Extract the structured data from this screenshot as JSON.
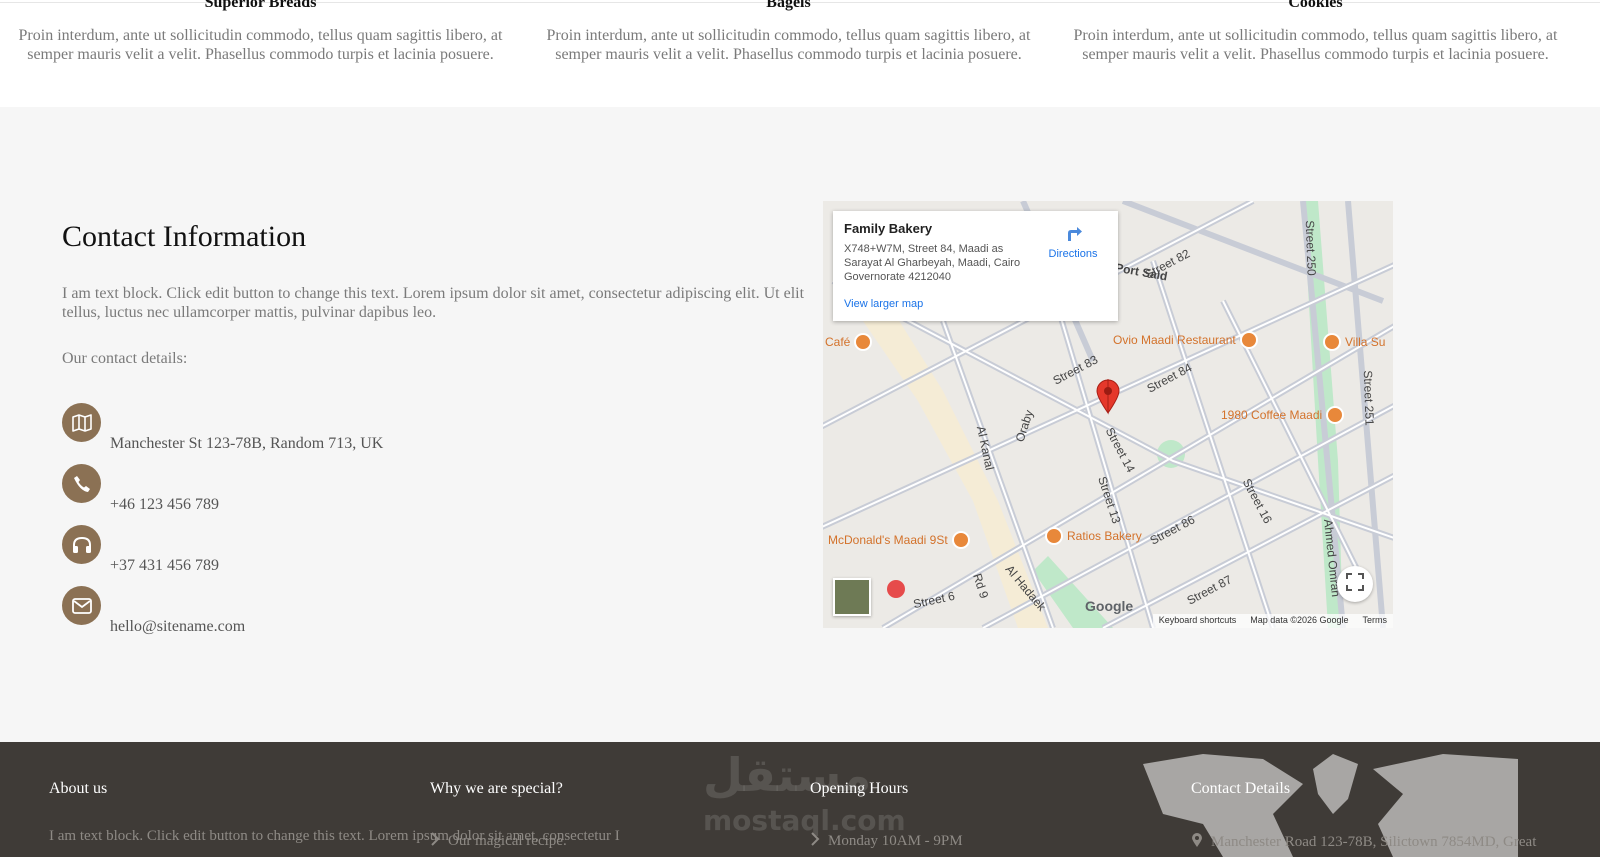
{
  "products": [
    {
      "title": "Superior Breads",
      "text": "Proin interdum, ante ut sollicitudin commodo, tellus quam sagittis libero, at semper mauris velit a velit. Phasellus commodo turpis et lacinia posuere."
    },
    {
      "title": "Bagels",
      "text": "Proin interdum, ante ut sollicitudin commodo, tellus quam sagittis libero, at semper mauris velit a velit. Phasellus commodo turpis et lacinia posuere."
    },
    {
      "title": "Cookies",
      "text": "Proin interdum, ante ut sollicitudin commodo, tellus quam sagittis libero, at semper mauris velit a velit. Phasellus commodo turpis et lacinia posuere."
    }
  ],
  "contact": {
    "title": "Contact Information",
    "intro": "I am text block. Click edit button to change this text. Lorem ipsum dolor sit amet, consectetur adipiscing elit. Ut elit tellus, luctus nec ullamcorper mattis, pulvinar dapibus leo.",
    "details_label": "Our contact details:",
    "items": [
      {
        "icon": "map-icon",
        "text": "Manchester St 123-78B, Random 713, UK"
      },
      {
        "icon": "phone-icon",
        "text": "+46 123 456 789"
      },
      {
        "icon": "headphones-icon",
        "text": "+37 431 456 789"
      },
      {
        "icon": "envelope-icon",
        "text": "hello@sitename.com"
      }
    ],
    "accent_color": "#8b7154"
  },
  "map": {
    "place_name": "Family Bakery",
    "address": "X748+W7M, Street 84, Maadi as Sarayat Al Gharbeyah, Maadi, Cairo Governorate 4212040",
    "directions": "Directions",
    "larger_map": "View larger map",
    "keyboard_shortcuts": "Keyboard shortcuts",
    "map_data": "Map data ©2026 Google",
    "terms": "Terms",
    "logo": "Google",
    "streets": [
      "Street 82",
      "Street 83",
      "Street 84",
      "Street 14",
      "Street 13",
      "Street 86",
      "Street 87",
      "Street 16",
      "Street 250",
      "Street 251",
      "Port Said",
      "Al Kanal",
      "Oraby",
      "Ahmed Omran",
      "Rd 9",
      "Street 6",
      "Al Hadaek"
    ],
    "pois": [
      "Ovio Maadi Restaurant",
      "1980 Coffee Maadi",
      "Villa Su",
      "Ratios Bakery",
      "McDonald's Maadi 9St",
      "Café"
    ]
  },
  "footer": {
    "about": {
      "title": "About us",
      "text": "I am text block. Click edit button to change this text. Lorem ipsum dolor sit amet, consectetur I"
    },
    "special": {
      "title": "Why we are special?",
      "item": "Our magical recipe."
    },
    "hours": {
      "title": "Opening Hours",
      "item": "Monday 10AM - 9PM"
    },
    "details": {
      "title": "Contact Details",
      "item": "Manchester Road 123-78B, Silictown 7854MD, Great"
    },
    "watermark_ar": "مستقل",
    "watermark_en": "mostaql.com",
    "bg_color": "#3f3b37"
  }
}
